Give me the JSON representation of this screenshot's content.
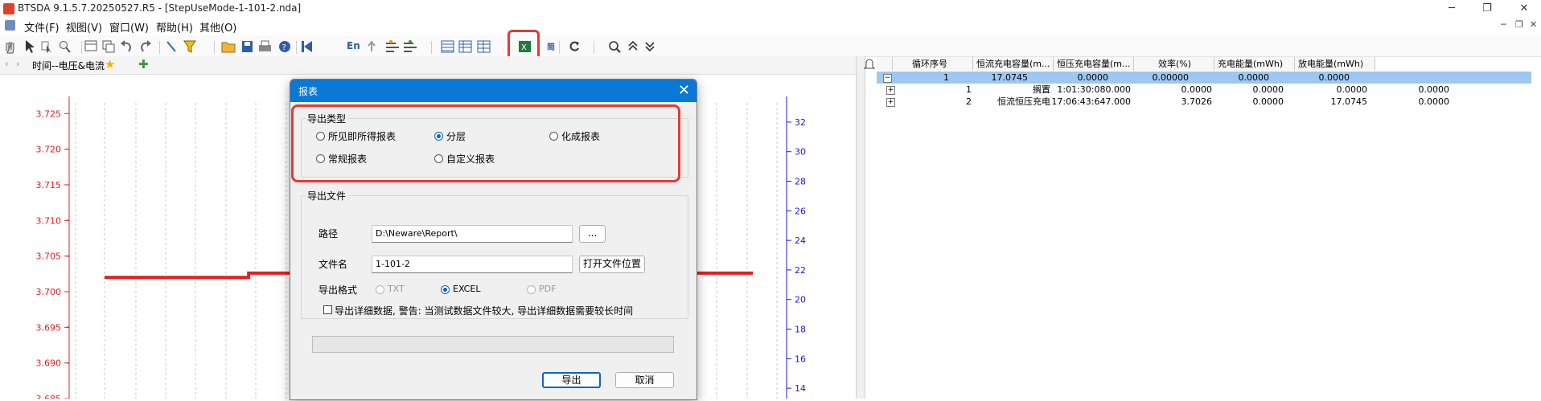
{
  "app": {
    "title": "BTSDA 9.1.5.7.20250527.R5 - [StepUseMode-1-101-2.nda]",
    "icon": "app-logo-icon"
  },
  "menu": [
    "文件(F)",
    "视图(V)",
    "窗口(W)",
    "帮助(H)",
    "其他(O)"
  ],
  "toolbar": {
    "en_label": "En",
    "highlighted_icon": "excel-export-icon"
  },
  "chart_tab": {
    "label": "时间--电压&电流"
  },
  "chart_data": {
    "type": "line",
    "y_left": {
      "ticks": [
        "3.725",
        "3.720",
        "3.715",
        "3.710",
        "3.705",
        "3.700",
        "3.695",
        "3.690",
        "3.685"
      ],
      "range": [
        3.685,
        3.7265
      ],
      "color": "#e02020"
    },
    "y_right": {
      "ticks": [
        "32",
        "30",
        "28",
        "26",
        "24",
        "22",
        "20",
        "18",
        "16",
        "14"
      ],
      "range": [
        13.3,
        33.3
      ],
      "color": "#1b1bd0"
    },
    "series": [
      {
        "color": "#e02020",
        "values": [
          3.702,
          3.702,
          3.7026,
          3.7026,
          3.7026,
          3.7026,
          3.7026,
          3.7026,
          3.7026,
          3.7026
        ]
      }
    ]
  },
  "table": {
    "headers": [
      "",
      "循环序号",
      "恒流充电容量(m...",
      "恒压充电容量(m...",
      "效率(%)",
      "充电能量(mWh)",
      "放电能量(mWh)"
    ],
    "rows": [
      {
        "cells": [
          "1",
          "17.0745",
          "0.0000",
          "0.00000",
          "0.0000",
          "0.0000"
        ],
        "selected": true,
        "expander": "−"
      },
      {
        "cells": [
          "1",
          "搁置",
          "1:01:30:080.000",
          "0.0000",
          "0.0000",
          "0.0000",
          "0.0000"
        ],
        "selected": false,
        "expander": "+"
      },
      {
        "cells": [
          "2",
          "恒流恒压充电",
          "17:06:43:647.000",
          "3.7026",
          "0.0000",
          "17.0745",
          "0.0000"
        ],
        "selected": false,
        "expander": "+"
      }
    ]
  },
  "dialog": {
    "title": "报表",
    "export_type": {
      "label": "导出类型",
      "options": [
        "所见即所得报表",
        "分层",
        "化成报表",
        "常规报表",
        "自定义报表"
      ],
      "selected": "分层"
    },
    "export_file": {
      "label": "导出文件",
      "path_label": "路径",
      "path_value": "D:\\Neware\\Report\\",
      "browse_label": "...",
      "filename_label": "文件名",
      "filename_value": "1-101-2",
      "open_location_label": "打开文件位置",
      "format_label": "导出格式",
      "formats": [
        "TXT",
        "EXCEL",
        "PDF"
      ],
      "format_selected": "EXCEL",
      "detail_checkbox_label": "导出详细数据, 警告: 当测试数据文件较大, 导出详细数据需要较长时间"
    },
    "export_button": "导出",
    "cancel_button": "取消"
  }
}
